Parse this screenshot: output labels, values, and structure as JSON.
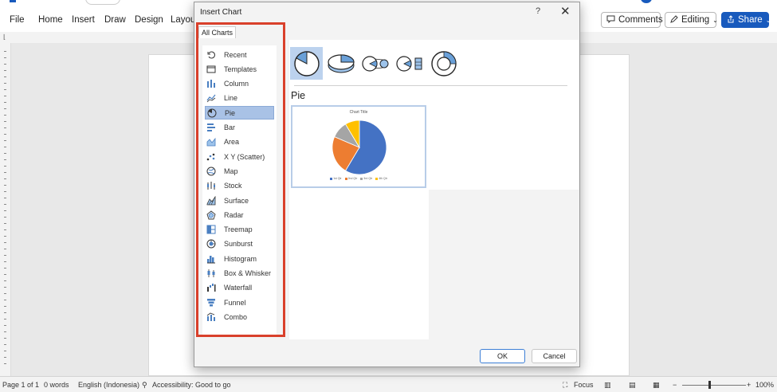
{
  "word": {
    "menu": [
      "File",
      "Home",
      "Insert",
      "Draw",
      "Design",
      "Layout"
    ],
    "comments_label": "Comments",
    "editing_label": "Editing",
    "share_label": "Share"
  },
  "status": {
    "page": "Page 1 of 1",
    "words": "0 words",
    "language": "English (Indonesia)",
    "accessibility": "Accessibility: Good to go",
    "focus": "Focus",
    "zoom": "100%"
  },
  "dialog": {
    "title": "Insert Chart",
    "help": "?",
    "close": "✕",
    "tab": "All Charts",
    "chart_types": [
      {
        "label": "Recent",
        "icon": "recent-icon"
      },
      {
        "label": "Templates",
        "icon": "templates-icon"
      },
      {
        "label": "Column",
        "icon": "column-icon"
      },
      {
        "label": "Line",
        "icon": "line-icon"
      },
      {
        "label": "Pie",
        "icon": "pie-icon"
      },
      {
        "label": "Bar",
        "icon": "bar-icon"
      },
      {
        "label": "Area",
        "icon": "area-icon"
      },
      {
        "label": "X Y (Scatter)",
        "icon": "scatter-icon"
      },
      {
        "label": "Map",
        "icon": "map-icon"
      },
      {
        "label": "Stock",
        "icon": "stock-icon"
      },
      {
        "label": "Surface",
        "icon": "surface-icon"
      },
      {
        "label": "Radar",
        "icon": "radar-icon"
      },
      {
        "label": "Treemap",
        "icon": "treemap-icon"
      },
      {
        "label": "Sunburst",
        "icon": "sunburst-icon"
      },
      {
        "label": "Histogram",
        "icon": "histogram-icon"
      },
      {
        "label": "Box & Whisker",
        "icon": "box-whisker-icon"
      },
      {
        "label": "Waterfall",
        "icon": "waterfall-icon"
      },
      {
        "label": "Funnel",
        "icon": "funnel-icon"
      },
      {
        "label": "Combo",
        "icon": "combo-icon"
      }
    ],
    "selected_type": "Pie",
    "subtypes": [
      "pie",
      "3-d-pie",
      "pie-of-pie",
      "bar-of-pie",
      "doughnut"
    ],
    "heading": "Pie",
    "preview": {
      "title": "Chart Title",
      "legend": [
        "1st Qtr",
        "2nd Qtr",
        "3rd Qtr",
        "4th Qtr"
      ],
      "colors": [
        "#4472c4",
        "#ed7d31",
        "#a5a5a5",
        "#ffc000"
      ],
      "values": [
        8.2,
        3.2,
        1.4,
        1.2
      ]
    },
    "ok_label": "OK",
    "cancel_label": "Cancel",
    "accent": "#d9402b",
    "selection": "#a9c2e6"
  }
}
